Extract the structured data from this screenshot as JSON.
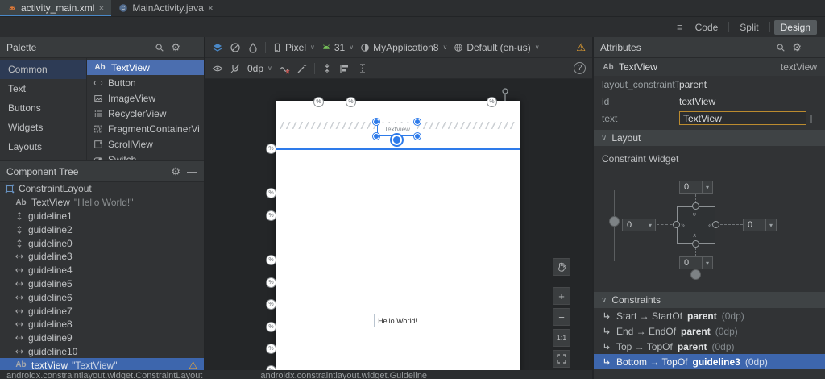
{
  "icons": {
    "close": "×",
    "gear": "⚙",
    "minimize": "—",
    "hamburger": "≡",
    "warning": "⚠",
    "help": "?",
    "plus": "+",
    "minus": "−",
    "ab": "Ab"
  },
  "window": {
    "tabs": [
      {
        "label": "activity_main.xml"
      },
      {
        "label": "MainActivity.java"
      }
    ],
    "view_controls": {
      "code": "Code",
      "split": "Split",
      "design": "Design"
    }
  },
  "palette": {
    "title": "Palette",
    "categories": [
      {
        "label": "Common"
      },
      {
        "label": "Text"
      },
      {
        "label": "Buttons"
      },
      {
        "label": "Widgets"
      },
      {
        "label": "Layouts"
      }
    ],
    "components": [
      {
        "label": "TextView"
      },
      {
        "label": "Button"
      },
      {
        "label": "ImageView"
      },
      {
        "label": "RecyclerView"
      },
      {
        "label": "FragmentContainerVi"
      },
      {
        "label": "ScrollView"
      },
      {
        "label": "Switch"
      }
    ]
  },
  "component_tree": {
    "title": "Component Tree",
    "items": [
      {
        "label": "ConstraintLayout"
      },
      {
        "label": "TextView",
        "note": "\"Hello World!\""
      },
      {
        "label": "guideline1"
      },
      {
        "label": "guideline2"
      },
      {
        "label": "guideline0"
      },
      {
        "label": "guideline3"
      },
      {
        "label": "guideline4"
      },
      {
        "label": "guideline5"
      },
      {
        "label": "guideline6"
      },
      {
        "label": "guideline7"
      },
      {
        "label": "guideline8"
      },
      {
        "label": "guideline9"
      },
      {
        "label": "guideline10"
      },
      {
        "label": "textView",
        "note": "\"TextView\""
      }
    ]
  },
  "design_toolbar": {
    "device": "Pixel",
    "api_level": "31",
    "app_theme": "MyApplication8",
    "locale": "Default (en-us)",
    "default_margin": "0dp"
  },
  "canvas": {
    "selected_widget_text": "TextView",
    "hello_text": "Hello World!",
    "zoom_label": "1:1"
  },
  "attributes": {
    "title": "Attributes",
    "selected_type": "TextView",
    "selected_id": "textView",
    "fields": [
      {
        "label": "layout_constraintTop...",
        "value": "parent"
      },
      {
        "label": "id",
        "value": "textView"
      },
      {
        "label": "text",
        "value": "TextView"
      }
    ],
    "layout_section": "Layout",
    "constraint_widget": {
      "label": "Constraint Widget",
      "margin_top": "0",
      "margin_left": "0",
      "margin_right": "0",
      "margin_bottom": "0"
    },
    "constraints_section": "Constraints",
    "constraints": [
      {
        "prefix": "Start → StartOf",
        "target": "parent",
        "suffix": "(0dp)"
      },
      {
        "prefix": "End → EndOf",
        "target": "parent",
        "suffix": "(0dp)"
      },
      {
        "prefix": "Top → TopOf",
        "target": "parent",
        "suffix": "(0dp)"
      },
      {
        "prefix": "Bottom → TopOf",
        "target": "guideline3",
        "suffix": "(0dp)"
      }
    ]
  },
  "status_bar": {
    "left": "androidx.constraintlayout.widget.ConstraintLayout",
    "right": "androidx.constraintlayout.widget.Guideline"
  }
}
